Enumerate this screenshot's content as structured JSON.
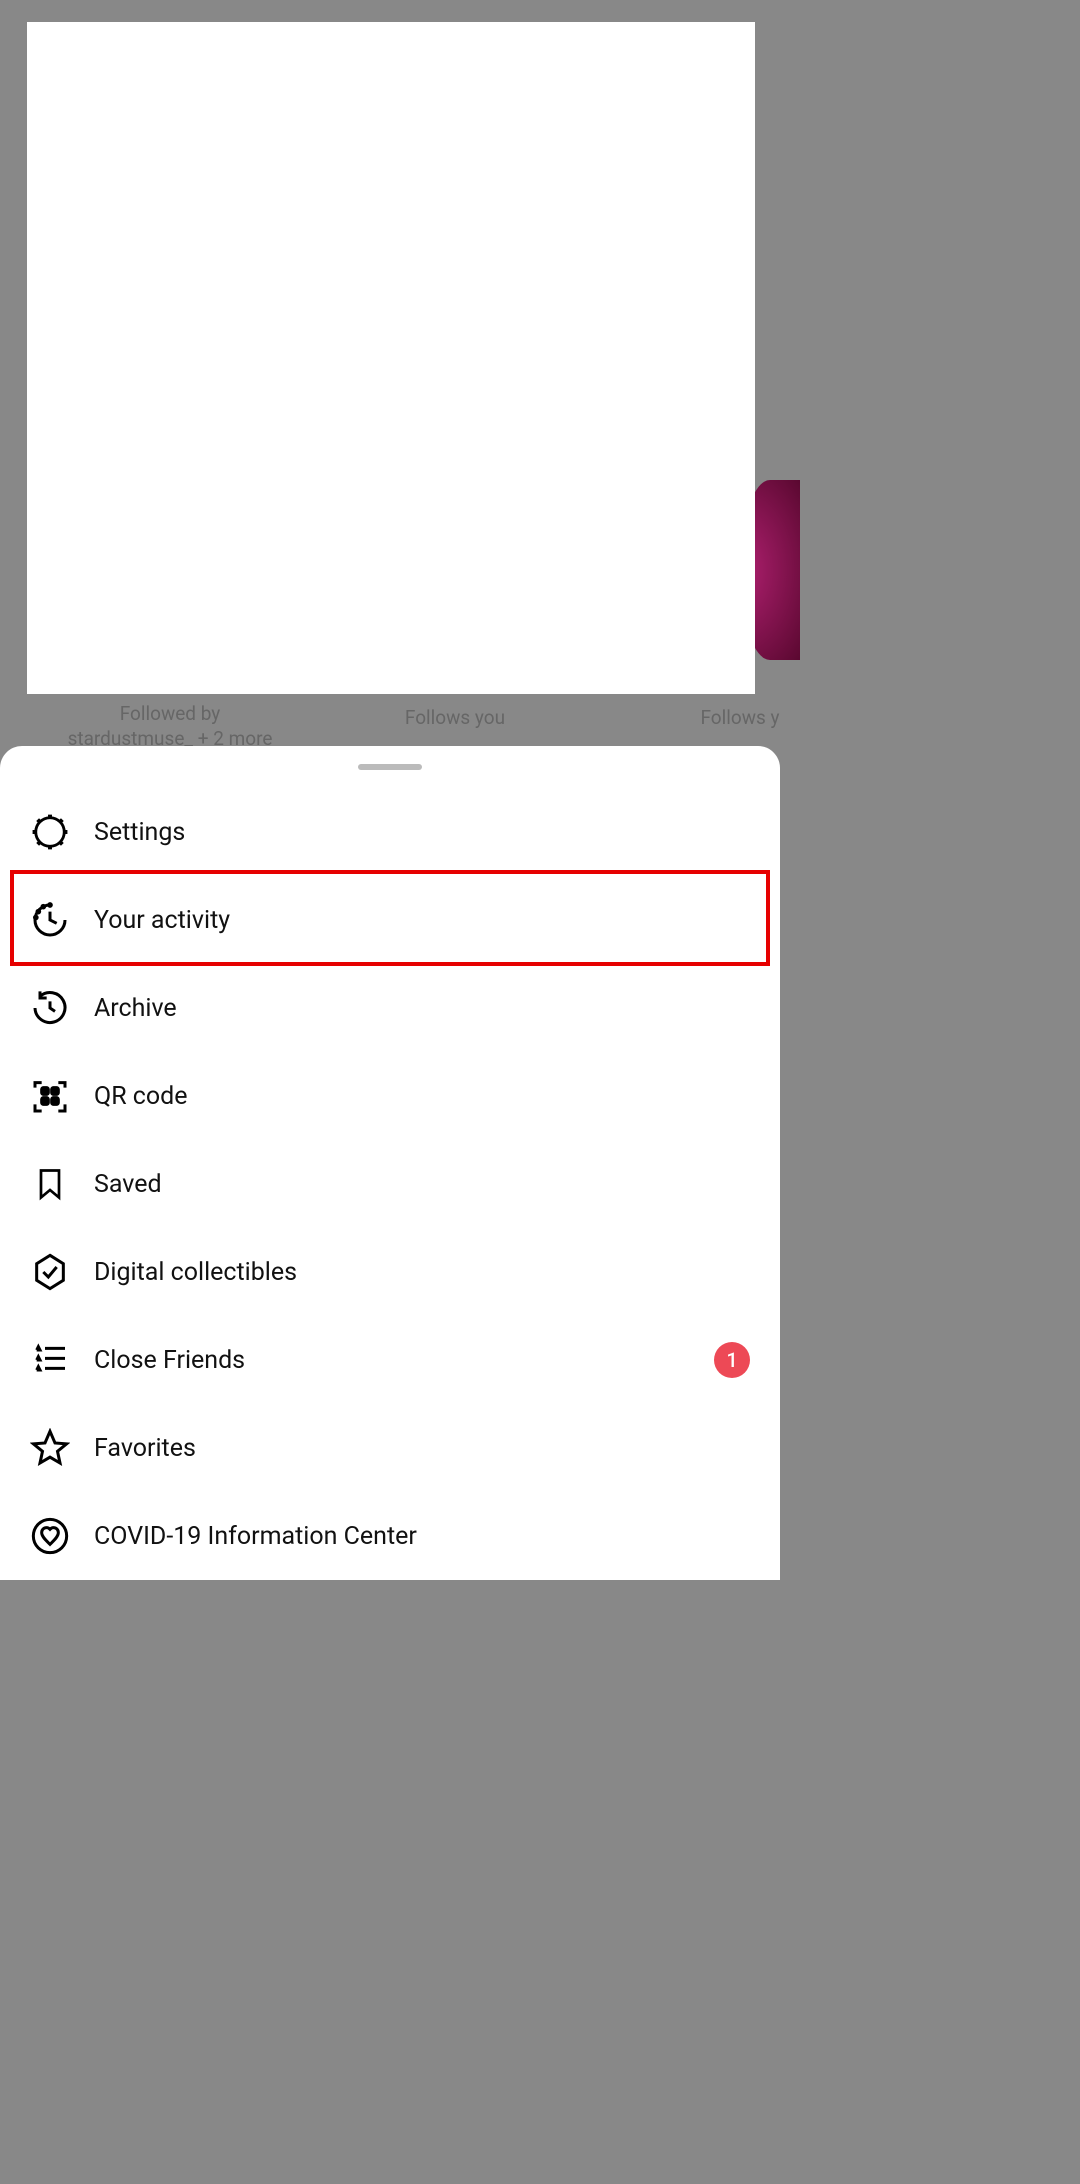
{
  "background": {
    "followed_by": "Followed by stardustmuse_ + 2 more",
    "follows_you_1": "Follows you",
    "follows_you_2": "Follows y"
  },
  "sheet": {
    "items": [
      {
        "label": "Settings",
        "icon": "settings-icon",
        "badge": null
      },
      {
        "label": "Your activity",
        "icon": "activity-icon",
        "badge": null
      },
      {
        "label": "Archive",
        "icon": "archive-icon",
        "badge": null
      },
      {
        "label": "QR code",
        "icon": "qr-icon",
        "badge": null
      },
      {
        "label": "Saved",
        "icon": "bookmark-icon",
        "badge": null
      },
      {
        "label": "Digital collectibles",
        "icon": "hexagon-check-icon",
        "badge": null
      },
      {
        "label": "Close Friends",
        "icon": "star-list-icon",
        "badge": "1"
      },
      {
        "label": "Favorites",
        "icon": "star-icon",
        "badge": null
      },
      {
        "label": "COVID-19 Information Center",
        "icon": "heart-circle-icon",
        "badge": null
      }
    ]
  },
  "highlight_index": 1
}
